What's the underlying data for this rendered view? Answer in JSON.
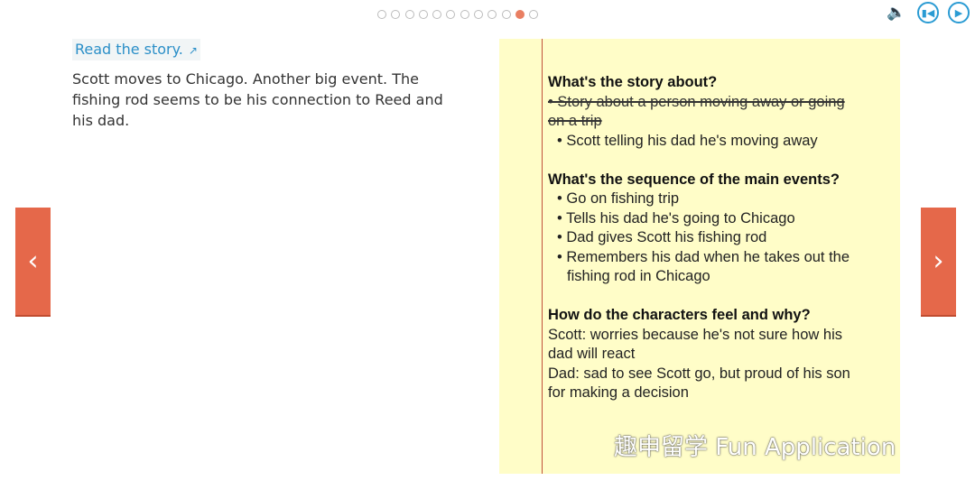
{
  "progress": {
    "total": 12,
    "current": 11
  },
  "controls": {
    "speaker_icon": "speaker-icon",
    "restart_icon": "skip-back-icon",
    "play_icon": "play-icon"
  },
  "read_link": {
    "label": "Read the story.",
    "icon": "external-link-icon"
  },
  "summary": "Scott moves to Chicago. Another big event. The fishing rod seems to be his connection to Reed and his dad.",
  "nav": {
    "prev_icon": "chevron-left-icon",
    "next_icon": "chevron-right-icon",
    "color": "#e5684a"
  },
  "notes": {
    "q1": "What's the story about?",
    "q1_struck": [
      "• Story about a person moving away or going",
      "on a trip"
    ],
    "q1_answer": "• Scott telling his dad he's moving away",
    "q2": "What's the sequence of the main events?",
    "q2_items": [
      "• Go on fishing trip",
      "• Tells his dad he's going to Chicago",
      "• Dad gives Scott his fishing rod",
      "• Remembers his dad when he takes out the",
      "fishing rod in Chicago"
    ],
    "q3": "How do the characters feel and why?",
    "q3_lines": [
      "Scott: worries because he's not sure how his",
      "dad will react",
      "Dad: sad to see Scott go, but proud of his son",
      "for making a decision"
    ]
  },
  "watermark": "趣申留学 Fun Application"
}
